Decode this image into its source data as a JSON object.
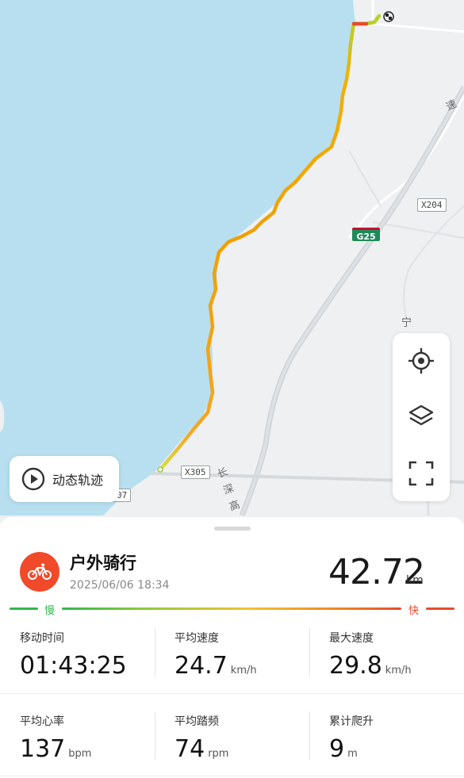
{
  "map": {
    "road_labels": {
      "x204": "X204",
      "x305": "X305",
      "r07": "07",
      "g25": "G25",
      "changshen": "长深高",
      "ning": "宁",
      "su": "速"
    },
    "controls": {
      "locate": "locate-icon",
      "layers": "layers-icon",
      "fullscreen": "fullscreen-icon"
    },
    "replay_label": "动态轨迹"
  },
  "activity": {
    "type": "户外骑行",
    "datetime": "2025/06/06 18:34",
    "distance": "42.72",
    "distance_unit": "km",
    "icon": "cycling-icon",
    "accent_color": "#f04a2a"
  },
  "pace_legend": {
    "slow": "慢",
    "fast": "快",
    "slow_color": "#2fb84a",
    "fast_color": "#e84a2a"
  },
  "stats": [
    {
      "label": "移动时间",
      "value": "01:43:25",
      "unit": ""
    },
    {
      "label": "平均速度",
      "value": "24.7",
      "unit": "km/h"
    },
    {
      "label": "最大速度",
      "value": "29.8",
      "unit": "km/h"
    },
    {
      "label": "平均心率",
      "value": "137",
      "unit": "bpm"
    },
    {
      "label": "平均踏频",
      "value": "74",
      "unit": "rpm"
    },
    {
      "label": "累计爬升",
      "value": "9",
      "unit": "m"
    }
  ]
}
